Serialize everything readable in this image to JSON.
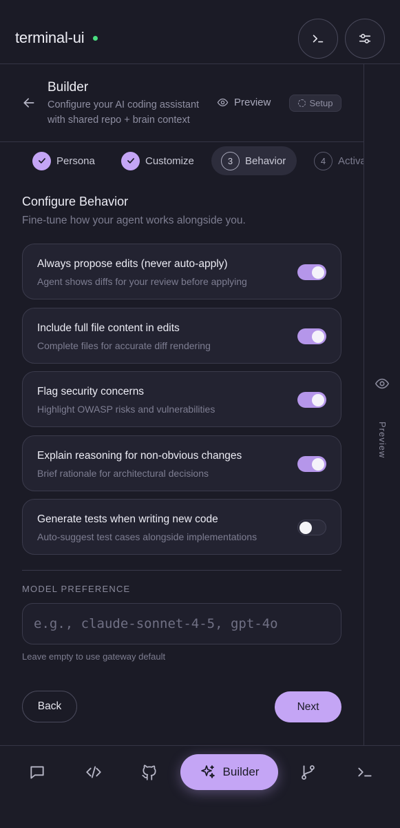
{
  "header": {
    "brand": "terminal-ui",
    "status_color": "#4ade80"
  },
  "builder": {
    "title": "Builder",
    "subtitle": "Configure your AI coding assistant with shared repo + brain context",
    "preview_label": "Preview",
    "setup_badge": "Setup"
  },
  "steps": [
    {
      "label": "Persona",
      "state": "done"
    },
    {
      "label": "Customize",
      "state": "done"
    },
    {
      "label": "Behavior",
      "state": "active",
      "number": "3"
    },
    {
      "label": "Activa",
      "state": "future",
      "number": "4"
    }
  ],
  "section": {
    "title": "Configure Behavior",
    "subtitle": "Fine-tune how your agent works alongside you."
  },
  "options": [
    {
      "title": "Always propose edits (never auto-apply)",
      "desc": "Agent shows diffs for your review before applying",
      "enabled": true
    },
    {
      "title": "Include full file content in edits",
      "desc": "Complete files for accurate diff rendering",
      "enabled": true
    },
    {
      "title": "Flag security concerns",
      "desc": "Highlight OWASP risks and vulnerabilities",
      "enabled": true
    },
    {
      "title": "Explain reasoning for non-obvious changes",
      "desc": "Brief rationale for architectural decisions",
      "enabled": true
    },
    {
      "title": "Generate tests when writing new code",
      "desc": "Auto-suggest test cases alongside implementations",
      "enabled": false
    }
  ],
  "model": {
    "label": "MODEL PREFERENCE",
    "value": "",
    "placeholder": "e.g., claude-sonnet-4-5, gpt-4o",
    "hint": "Leave empty to use gateway default"
  },
  "actions": {
    "back": "Back",
    "next": "Next"
  },
  "rail": {
    "label": "Preview"
  },
  "nav": {
    "builder_label": "Builder",
    "icons": [
      "chat-icon",
      "code-icon",
      "github-icon",
      "sparkles-icon",
      "git-branch-icon",
      "terminal-icon"
    ]
  },
  "colors": {
    "accent": "#c4a5f5",
    "background": "#1b1b26",
    "card": "#232331"
  }
}
